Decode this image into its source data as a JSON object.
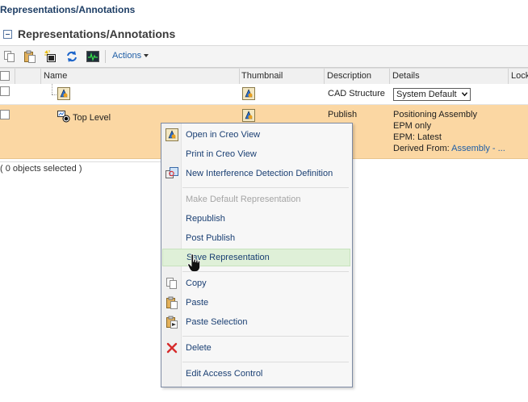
{
  "breadcrumb": "Representations/Annotations",
  "section": {
    "title": "Representations/Annotations"
  },
  "toolbar": {
    "actions_label": "Actions"
  },
  "table": {
    "columns": [
      "Name",
      "Thumbnail",
      "Description",
      "Details",
      "Lock"
    ],
    "rows": [
      {
        "name": "",
        "description": "CAD Structure",
        "details_select": "System Default"
      },
      {
        "name": "Top Level",
        "description": "Publish",
        "details": [
          "Positioning Assembly",
          "EPM only",
          "EPM: Latest"
        ],
        "derived_from_label": "Derived From:",
        "derived_from_link": "Assembly - ..."
      }
    ]
  },
  "footer": {
    "selection": "( 0 objects selected )"
  },
  "context_menu": {
    "items": [
      {
        "label": "Open in Creo View",
        "icon": "creo-view-icon",
        "enabled": true
      },
      {
        "label": "Print in Creo View",
        "icon": "",
        "enabled": true
      },
      {
        "label": "New Interference Detection Definition",
        "icon": "interference-icon",
        "enabled": true
      },
      {
        "label": "Make Default Representation",
        "icon": "",
        "enabled": false
      },
      {
        "label": "Republish",
        "icon": "",
        "enabled": true
      },
      {
        "label": "Post Publish",
        "icon": "",
        "enabled": true
      },
      {
        "label": "Save Representation",
        "icon": "",
        "enabled": true,
        "hovered": true
      },
      {
        "label": "Copy",
        "icon": "copy-icon",
        "enabled": true
      },
      {
        "label": "Paste",
        "icon": "paste-icon",
        "enabled": true
      },
      {
        "label": "Paste Selection",
        "icon": "paste-selection-icon",
        "enabled": true
      },
      {
        "label": "Delete",
        "icon": "delete-icon",
        "enabled": true
      },
      {
        "label": "Edit Access Control",
        "icon": "",
        "enabled": true
      }
    ]
  },
  "colors": {
    "row_selected": "#fbd7a3",
    "menu_hover": "#dff0d8",
    "link": "#1f5ea6",
    "delete_red": "#d62b2b"
  }
}
